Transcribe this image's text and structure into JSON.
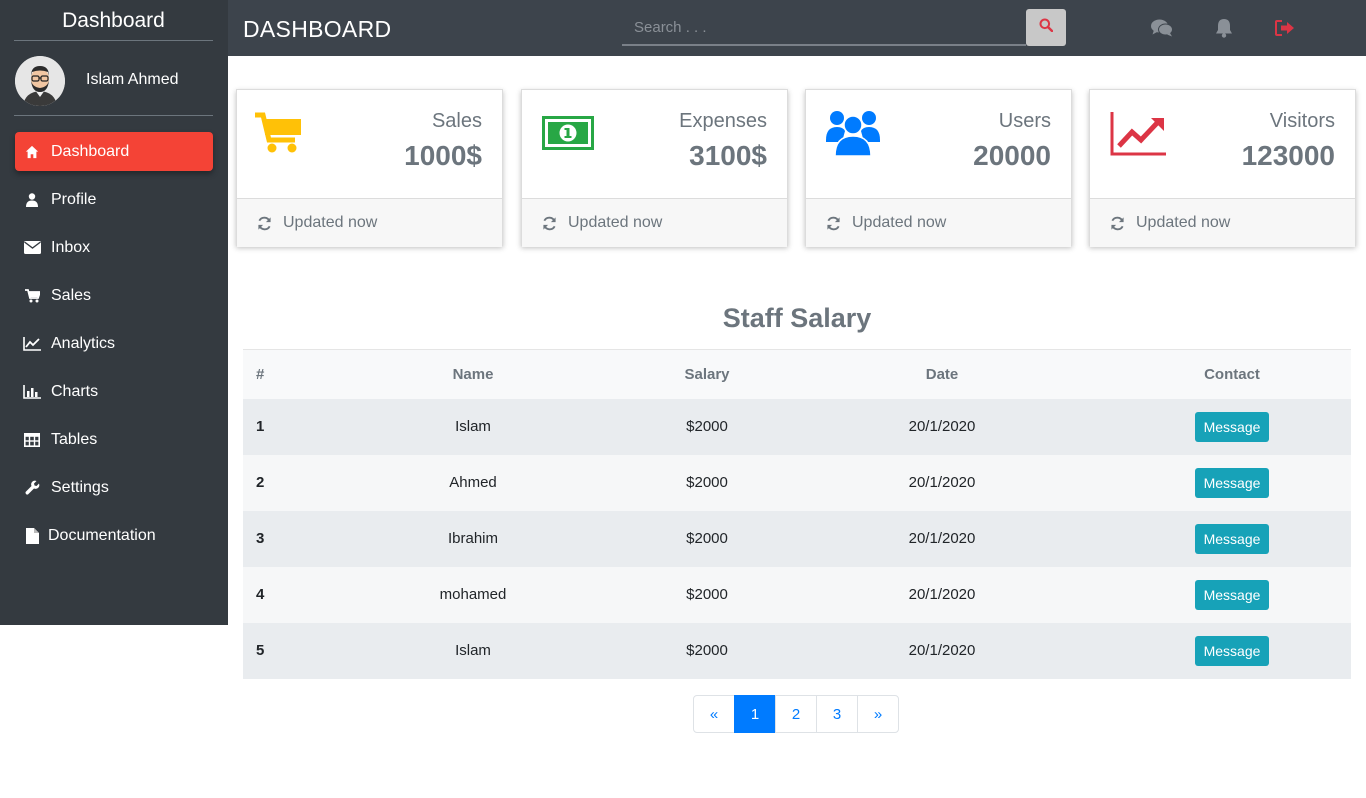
{
  "sidebar": {
    "brand": "Dashboard",
    "user_name": "Islam Ahmed",
    "items": [
      {
        "label": "Dashboard",
        "icon": "home-icon",
        "active": true
      },
      {
        "label": "Profile",
        "icon": "user-icon"
      },
      {
        "label": "Inbox",
        "icon": "envelope-icon"
      },
      {
        "label": "Sales",
        "icon": "cart-icon"
      },
      {
        "label": "Analytics",
        "icon": "line-chart-icon"
      },
      {
        "label": "Charts",
        "icon": "bar-chart-icon"
      },
      {
        "label": "Tables",
        "icon": "table-icon"
      },
      {
        "label": "Settings",
        "icon": "wrench-icon"
      },
      {
        "label": "Documentation",
        "icon": "file-icon"
      }
    ]
  },
  "header": {
    "title": "DASHBOARD",
    "search_placeholder": "Search . . .",
    "icons": [
      "search-icon",
      "comments-icon",
      "bell-icon",
      "sign-out-icon"
    ]
  },
  "cards": [
    {
      "label": "Sales",
      "value": "1000$",
      "footer": "Updated now",
      "icon": "cart-icon",
      "color": "#ffc107"
    },
    {
      "label": "Expenses",
      "value": "3100$",
      "footer": "Updated now",
      "icon": "money-icon",
      "color": "#28a745"
    },
    {
      "label": "Users",
      "value": "20000",
      "footer": "Updated now",
      "icon": "users-icon",
      "color": "#007bff"
    },
    {
      "label": "Visitors",
      "value": "123000",
      "footer": "Updated now",
      "icon": "line-chart-icon",
      "color": "#dc3545"
    }
  ],
  "table": {
    "title": "Staff Salary",
    "columns": [
      "#",
      "Name",
      "Salary",
      "Date",
      "Contact"
    ],
    "rows": [
      {
        "num": "1",
        "name": "Islam",
        "salary": "$2000",
        "date": "20/1/2020",
        "contact": "Message"
      },
      {
        "num": "2",
        "name": "Ahmed",
        "salary": "$2000",
        "date": "20/1/2020",
        "contact": "Message"
      },
      {
        "num": "3",
        "name": "Ibrahim",
        "salary": "$2000",
        "date": "20/1/2020",
        "contact": "Message"
      },
      {
        "num": "4",
        "name": "mohamed",
        "salary": "$2000",
        "date": "20/1/2020",
        "contact": "Message"
      },
      {
        "num": "5",
        "name": "Islam",
        "salary": "$2000",
        "date": "20/1/2020",
        "contact": "Message"
      }
    ]
  },
  "pagination": {
    "prev": "«",
    "pages": [
      "1",
      "2",
      "3"
    ],
    "next": "»",
    "active": "1"
  },
  "colors": {
    "sidebar_bg": "#343a40",
    "topbar_bg": "#3d444c",
    "active_item": "#f44336",
    "message_button": "#17a2b8",
    "pagination_active": "#007bff"
  }
}
